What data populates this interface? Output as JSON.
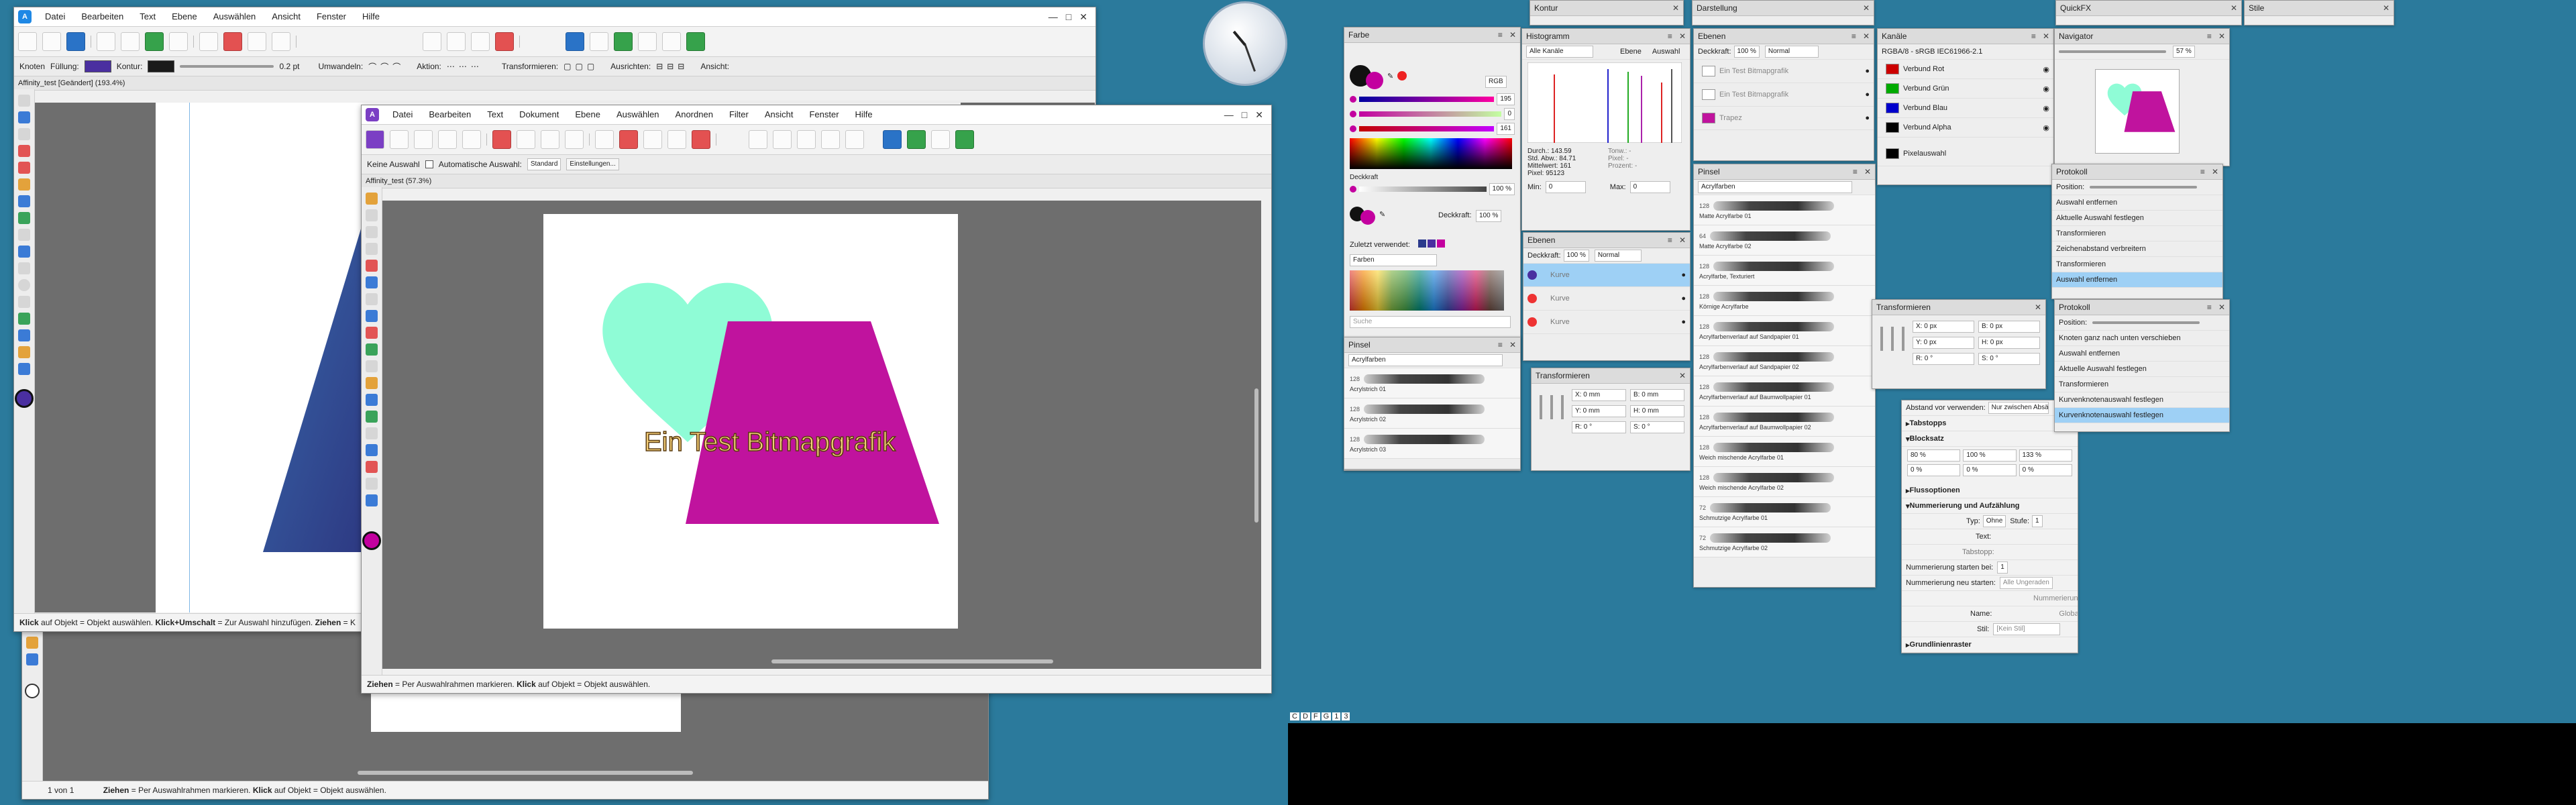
{
  "desktop": {
    "background": "#2b7a9c",
    "taskbar_tags": [
      "C",
      "D",
      "F",
      "G",
      "1",
      "3"
    ]
  },
  "app1": {
    "menu": [
      "Datei",
      "Bearbeiten",
      "Text",
      "Ebene",
      "Auswählen",
      "Ansicht",
      "Fenster",
      "Hilfe"
    ],
    "context_bar": {
      "mode": "Knoten",
      "fill_label": "Füllung:",
      "stroke_label": "Kontur:",
      "stroke_width": "0.2 pt",
      "convert_label": "Umwandeln:",
      "action_label": "Aktion:",
      "transform_label": "Transformieren:",
      "align_label": "Ausrichten:",
      "view_label": "Ansicht:"
    },
    "doc_tab": "Affinity_test [Geändert] (193.4%)",
    "status": {
      "k1": "Klick",
      "t1": " auf Objekt = Objekt auswählen. ",
      "k2": "Klick+Umschalt",
      "t2": " = Zur Auswahl hinzufügen. ",
      "k3": "Ziehen",
      "t3": " = K"
    },
    "colors": {
      "accent": "#2b3a8c",
      "fill": "#4a2fa0",
      "stroke": "#1a1a1a"
    }
  },
  "app3": {
    "page_indicator": "1 von 1",
    "status": {
      "k1": "Ziehen",
      "t1": " = Per Auswahlrahmen markieren. ",
      "k2": "Klick",
      "t2": " auf Objekt = Objekt auswählen."
    }
  },
  "app2": {
    "menu": [
      "Datei",
      "Bearbeiten",
      "Text",
      "Dokument",
      "Ebene",
      "Auswählen",
      "Anordnen",
      "Filter",
      "Ansicht",
      "Fenster",
      "Hilfe"
    ],
    "context_bar": {
      "no_selection": "Keine Auswahl",
      "auto_select": "Automatische Auswahl:",
      "auto_select_value": "Standard",
      "settings_button": "Einstellungen..."
    },
    "doc_tab": "Affinity_test (57.3%)",
    "canvas_text": "Ein Test Bitmapgrafik",
    "status": {
      "k1": "Ziehen",
      "t1": " = Per Auswahlrahmen markieren. ",
      "k2": "Klick",
      "t2": " auf Objekt = Objekt auswählen."
    },
    "colors": {
      "heart": "#8ffcd6",
      "trapezoid": "#c0139e",
      "page": "#ffffff",
      "workspace": "#6e6e6e",
      "text": "#f6d17a"
    }
  },
  "panels": {
    "farbe": {
      "title": "Farbe",
      "mode": "RGB",
      "rgb": [
        "195",
        "0",
        "161"
      ],
      "opacity_label": "Deckkraft",
      "opacity_value": "100 %",
      "opacity2_label": "Deckkraft:",
      "opacity2_value": "100 %",
      "recent_label": "Zuletzt verwendet:",
      "palette_label": "Farben",
      "search_placeholder": "Suche",
      "current_color": "#c3009f"
    },
    "pinsel_small": {
      "title": "Pinsel",
      "category": "Acrylfarben",
      "brushes": [
        {
          "num": "128",
          "name": "Acrylstrich 01"
        },
        {
          "num": "128",
          "name": "Acrylstrich 02"
        },
        {
          "num": "128",
          "name": "Acrylstrich 03"
        }
      ]
    },
    "kontur": {
      "title": "Kontur"
    },
    "histogramm": {
      "title": "Histogramm",
      "channel": "Alle Kanäle",
      "layer": "Ebene",
      "select": "Auswahl",
      "stats": [
        "Durch.: 143.59",
        "Std. Abw.: 84.71",
        "Mittelwert: 161",
        "Pixel: 95123"
      ],
      "stats_right": [
        "Tonw.: -",
        "Pixel: -",
        "Prozent: -"
      ],
      "min_label": "Min:",
      "min_value": "0",
      "max_label": "Max:",
      "max_value": "0"
    },
    "ebenen_small": {
      "title": "Ebenen",
      "opacity_value": "100 %",
      "blend_value": "Normal",
      "layers": [
        {
          "name": "Kurve"
        },
        {
          "name": "Kurve"
        },
        {
          "name": "Kurve"
        }
      ]
    },
    "transformieren_small": {
      "title": "Transformieren",
      "fields": [
        "X: 0 mm",
        "B: 0 mm",
        "Y: 0 mm",
        "H: 0 mm",
        "R: 0 °",
        "S: 0 °"
      ]
    },
    "darstellung": {
      "title": "Darstellung"
    },
    "ebenen_main": {
      "title": "Ebenen",
      "opacity_label": "Deckkraft:",
      "opacity_value": "100 %",
      "blend_value": "Normal",
      "layers": [
        {
          "name": "Ein Test Bitmapgrafik"
        },
        {
          "name": "Ein Test Bitmapgrafik"
        },
        {
          "name": "Trapez"
        }
      ]
    },
    "pinsel_main": {
      "title": "Pinsel",
      "category": "Acrylfarben",
      "brushes": [
        {
          "num": "128",
          "name": "Matte Acrylfarbe 01"
        },
        {
          "num": "64",
          "name": "Matte Acrylfarbe 02"
        },
        {
          "num": "128",
          "name": "Acrylfarbe, Texturiert"
        },
        {
          "num": "128",
          "name": "Körnige Acrylfarbe"
        },
        {
          "num": "128",
          "name": "Acrylfarbenverlauf auf Sandpapier 01"
        },
        {
          "num": "128",
          "name": "Acrylfarbenverlauf auf Sandpapier 02"
        },
        {
          "num": "128",
          "name": "Acrylfarbenverlauf auf Baumwollpapier 01"
        },
        {
          "num": "128",
          "name": "Acrylfarbenverlauf auf Baumwollpapier 02"
        },
        {
          "num": "128",
          "name": "Weich mischende Acrylfarbe 01"
        },
        {
          "num": "128",
          "name": "Weich mischende Acrylfarbe 02"
        },
        {
          "num": "72",
          "name": "Schmutzige Acrylfarbe 01"
        },
        {
          "num": "72",
          "name": "Schmutzige Acrylfarbe 02"
        }
      ]
    },
    "kanale": {
      "title": "Kanäle",
      "profile": "RGBA/8 - sRGB IEC61966-2.1",
      "channels": [
        "Verbund Rot",
        "Verbund Grün",
        "Verbund Blau",
        "Verbund Alpha",
        "Pixelauswahl"
      ]
    },
    "quickfx": {
      "title": "QuickFX"
    },
    "transformieren_main": {
      "title": "Transformieren",
      "fields": [
        "X: 0 px",
        "B: 0 px",
        "Y: 0 px",
        "H: 0 px",
        "R: 0 °",
        "S: 0 °"
      ]
    },
    "absatz": {
      "spacing_label": "Abstand vor verwenden:",
      "spacing_value": "Nur zwischen Absätzen",
      "sections": [
        "Tabstopps",
        "Blocksatz",
        "Flussoptionen",
        "Nummerierung und Aufzählung",
        "Grundlinienraster"
      ],
      "justify_values": [
        "80 %",
        "100 %",
        "133 %",
        "0 %",
        "0 %",
        "0 %"
      ],
      "typ_label": "Typ:",
      "typ_value": "Ohne",
      "stufe_label": "Stufe:",
      "stufe_value": "1",
      "text_label": "Text:",
      "tabstop_label": "Tabstopp:",
      "num_start_label": "Nummerierung starten bei:",
      "num_start_value": "1",
      "num_restart_label": "Nummerierung neu starten:",
      "num_restart_value": "Alle Ungeraden",
      "numbering_label": "Nummerierung",
      "name_label": "Name:",
      "global_label": "Global",
      "stil_label": "Stil:",
      "stil_value": "[Kein Stil]"
    },
    "stile": {
      "title": "Stile"
    },
    "navigator": {
      "title": "Navigator",
      "zoom": "57 %"
    },
    "protokoll_1": {
      "title": "Protokoll",
      "position_label": "Position:",
      "items": [
        "Auswahl entfernen",
        "Aktuelle Auswahl festlegen",
        "Transformieren",
        "Zeichenabstand verbreitern",
        "Transformieren",
        "Auswahl entfernen"
      ],
      "selected_index": 5
    },
    "protokoll_2": {
      "title": "Protokoll",
      "position_label": "Position:",
      "items": [
        "Knoten ganz nach unten verschieben",
        "Auswahl entfernen",
        "Aktuelle Auswahl festlegen",
        "Transformieren",
        "Kurvenknotenauswahl festlegen",
        "Kurvenknotenauswahl festlegen"
      ],
      "selected_index": 5
    }
  }
}
